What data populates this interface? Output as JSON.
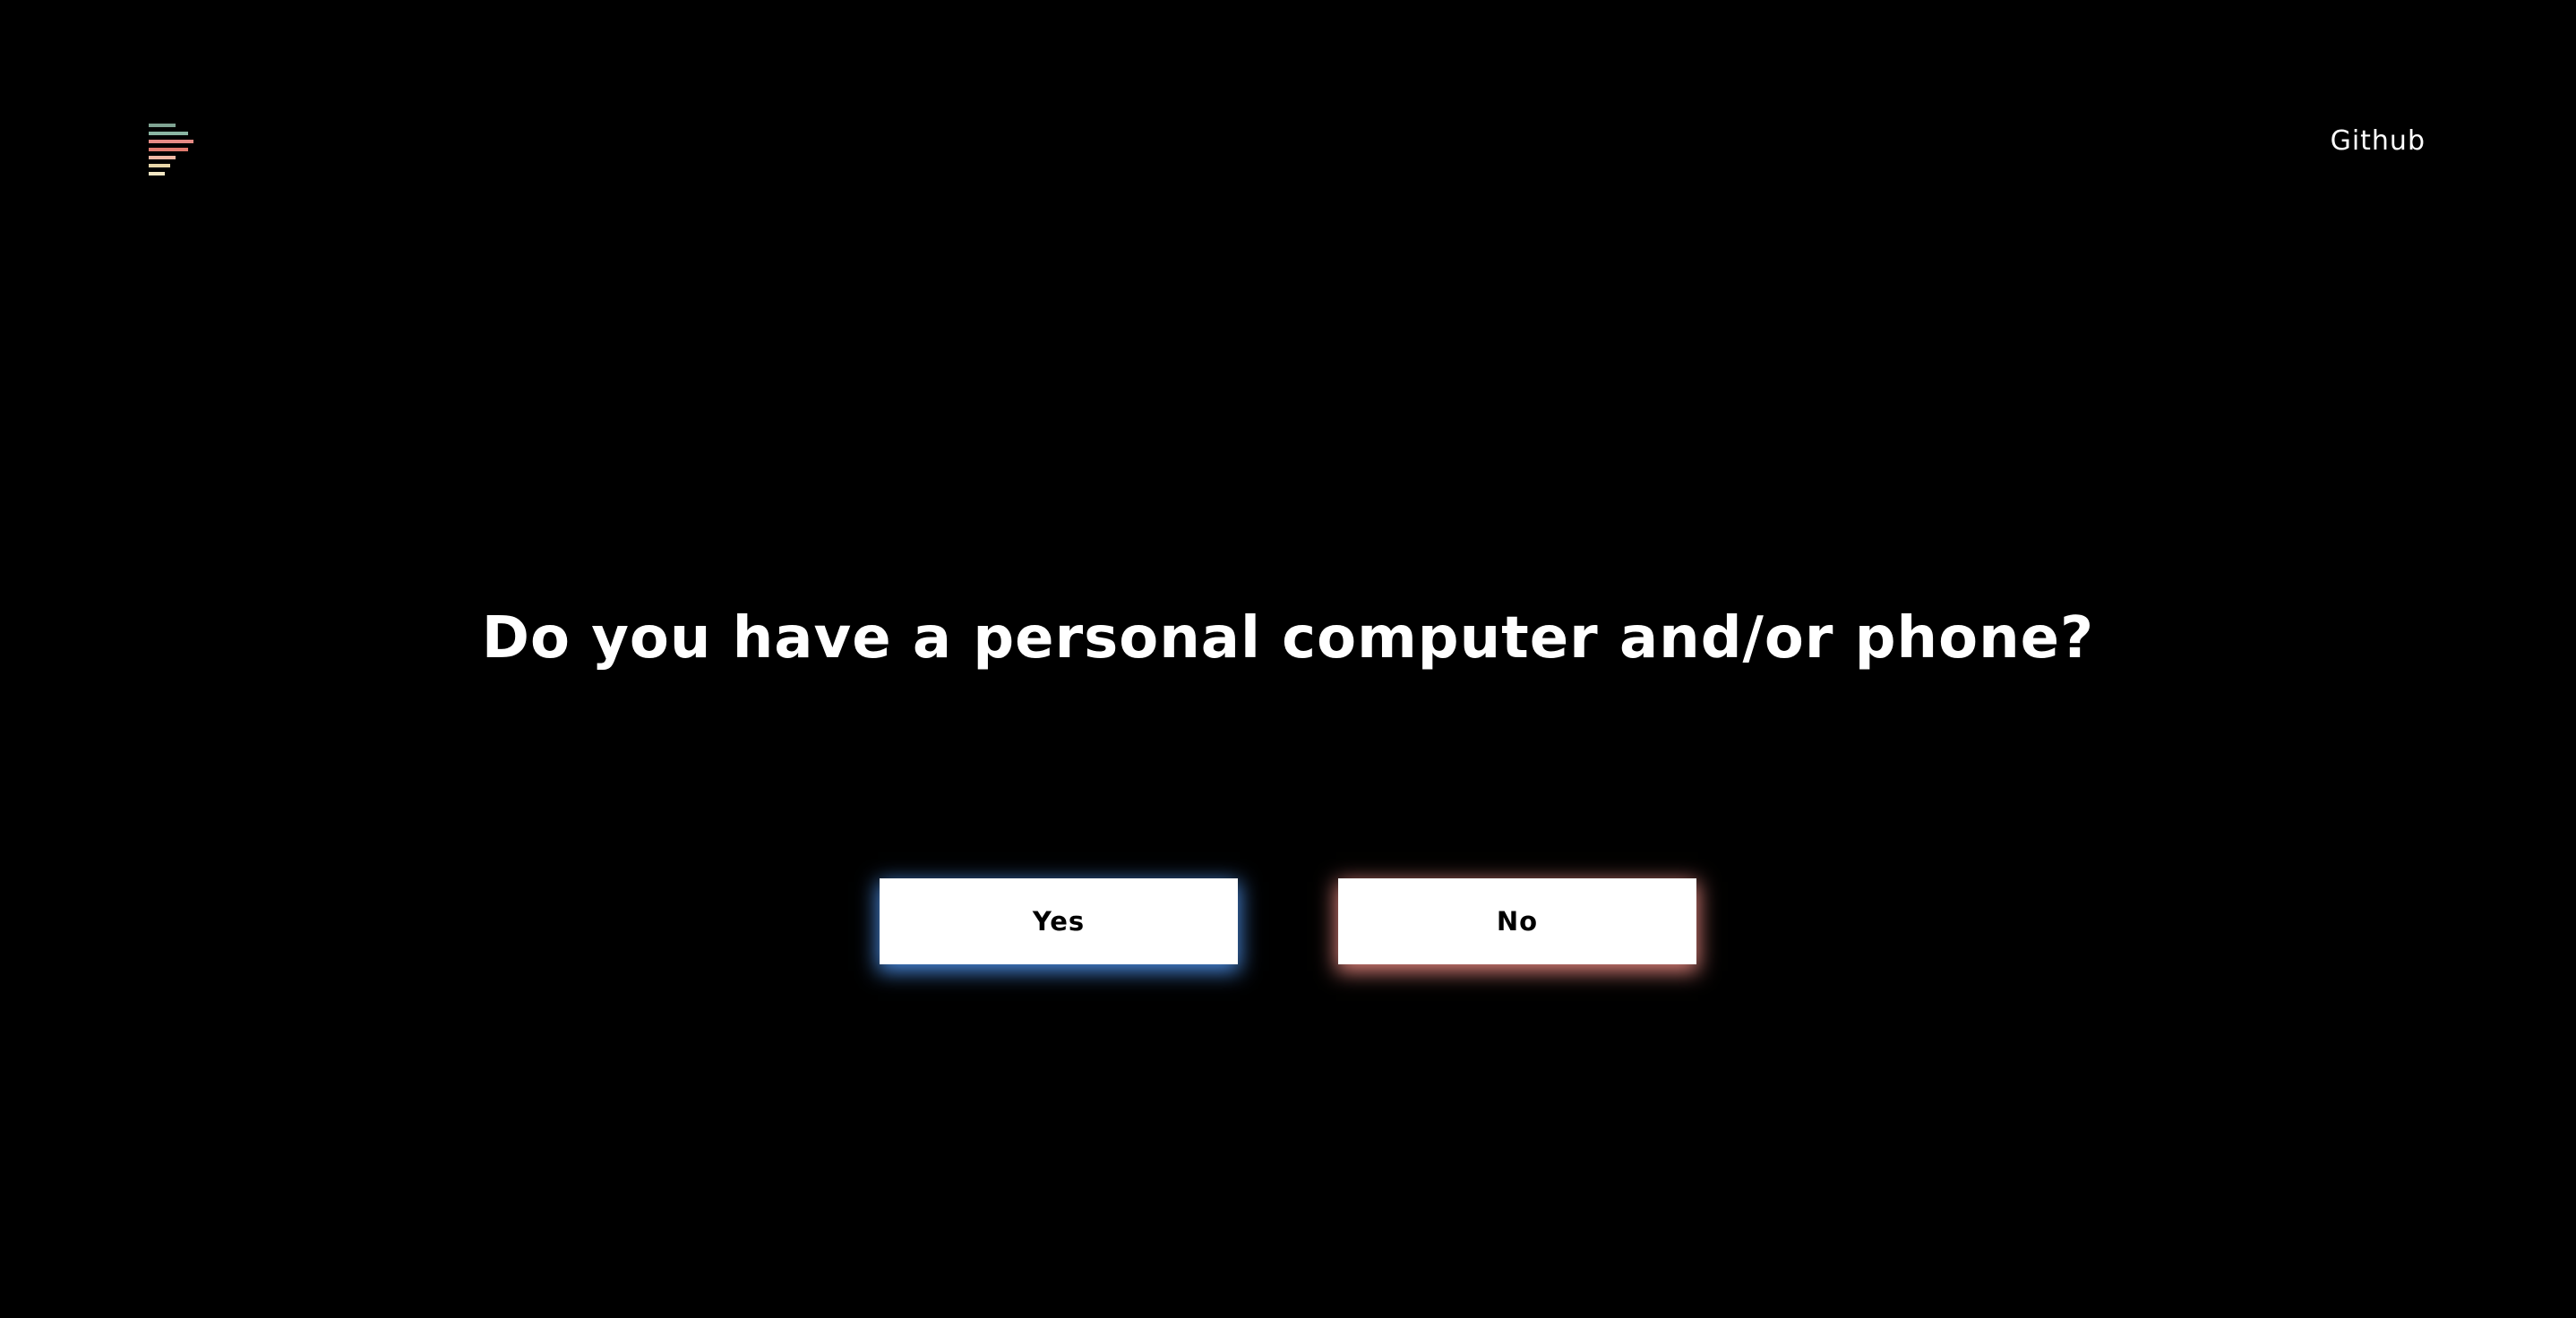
{
  "header": {
    "logo_icon": "stacked-bars-logo-icon",
    "logo_colors": [
      "#7fa392",
      "#8ab5a3",
      "#e58a84",
      "#e07a6e",
      "#f0b8a4",
      "#e8d6a8",
      "#f2e6c4"
    ],
    "github_label": "Github"
  },
  "main": {
    "question": "Do you have a personal computer and/or phone?",
    "yes_label": "Yes",
    "no_label": "No",
    "yes_glow_color": "#4a8be0",
    "no_glow_color": "#e0837c"
  }
}
